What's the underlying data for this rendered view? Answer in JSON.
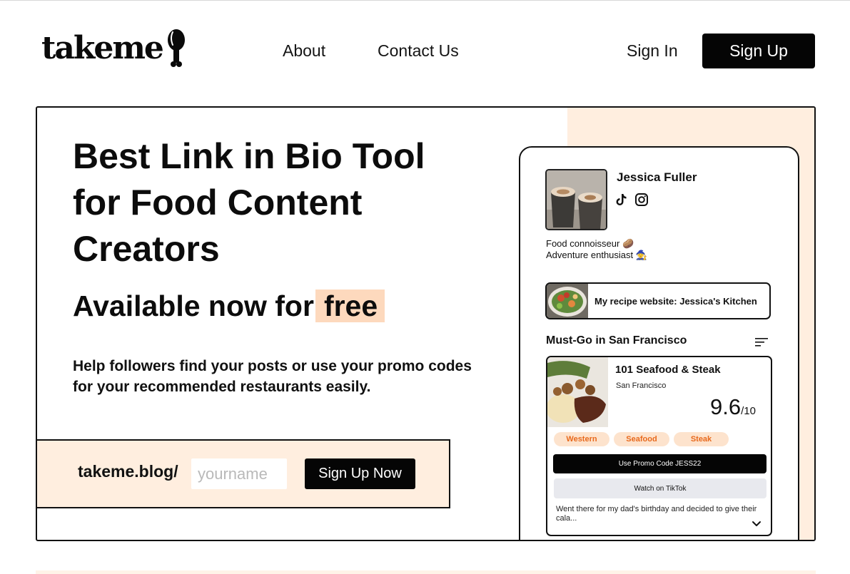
{
  "header": {
    "logo_text": "takeme",
    "nav": {
      "about": "About",
      "contact": "Contact Us"
    },
    "sign_in": "Sign In",
    "sign_up": "Sign Up"
  },
  "hero": {
    "title": "Best Link in Bio Tool for Food Content Creators",
    "subtitle_prefix": "Available now for",
    "subtitle_highlight": "free",
    "description": "Help followers find your posts or use your promo codes for your recommended restaurants easily.",
    "url_prefix": "takeme.blog/",
    "username_placeholder": "yourname",
    "cta_label": "Sign Up Now"
  },
  "profile": {
    "name": "Jessica Fuller",
    "bio_line1": "Food connoisseur 🥔",
    "bio_line2": "Adventure enthusiast 🧙",
    "link_label": "My recipe website:  Jessica's Kitchen",
    "section_title": "Must-Go in San Francisco",
    "restaurant": {
      "name": "101 Seafood & Steak",
      "city": "San Francisco",
      "rating": "9.6",
      "rating_scale": "/10",
      "tags": [
        "Western",
        "Seafood",
        "Steak"
      ],
      "promo_label": "Use Promo Code JESS22",
      "tiktok_label": "Watch on TikTok",
      "review": "Went there for my dad's birthday and decided to give their cala..."
    }
  },
  "colors": {
    "accent_peach": "#ffeedf",
    "highlight": "#fdd9bd",
    "tag_text": "#e8691c",
    "button": "#050505"
  }
}
